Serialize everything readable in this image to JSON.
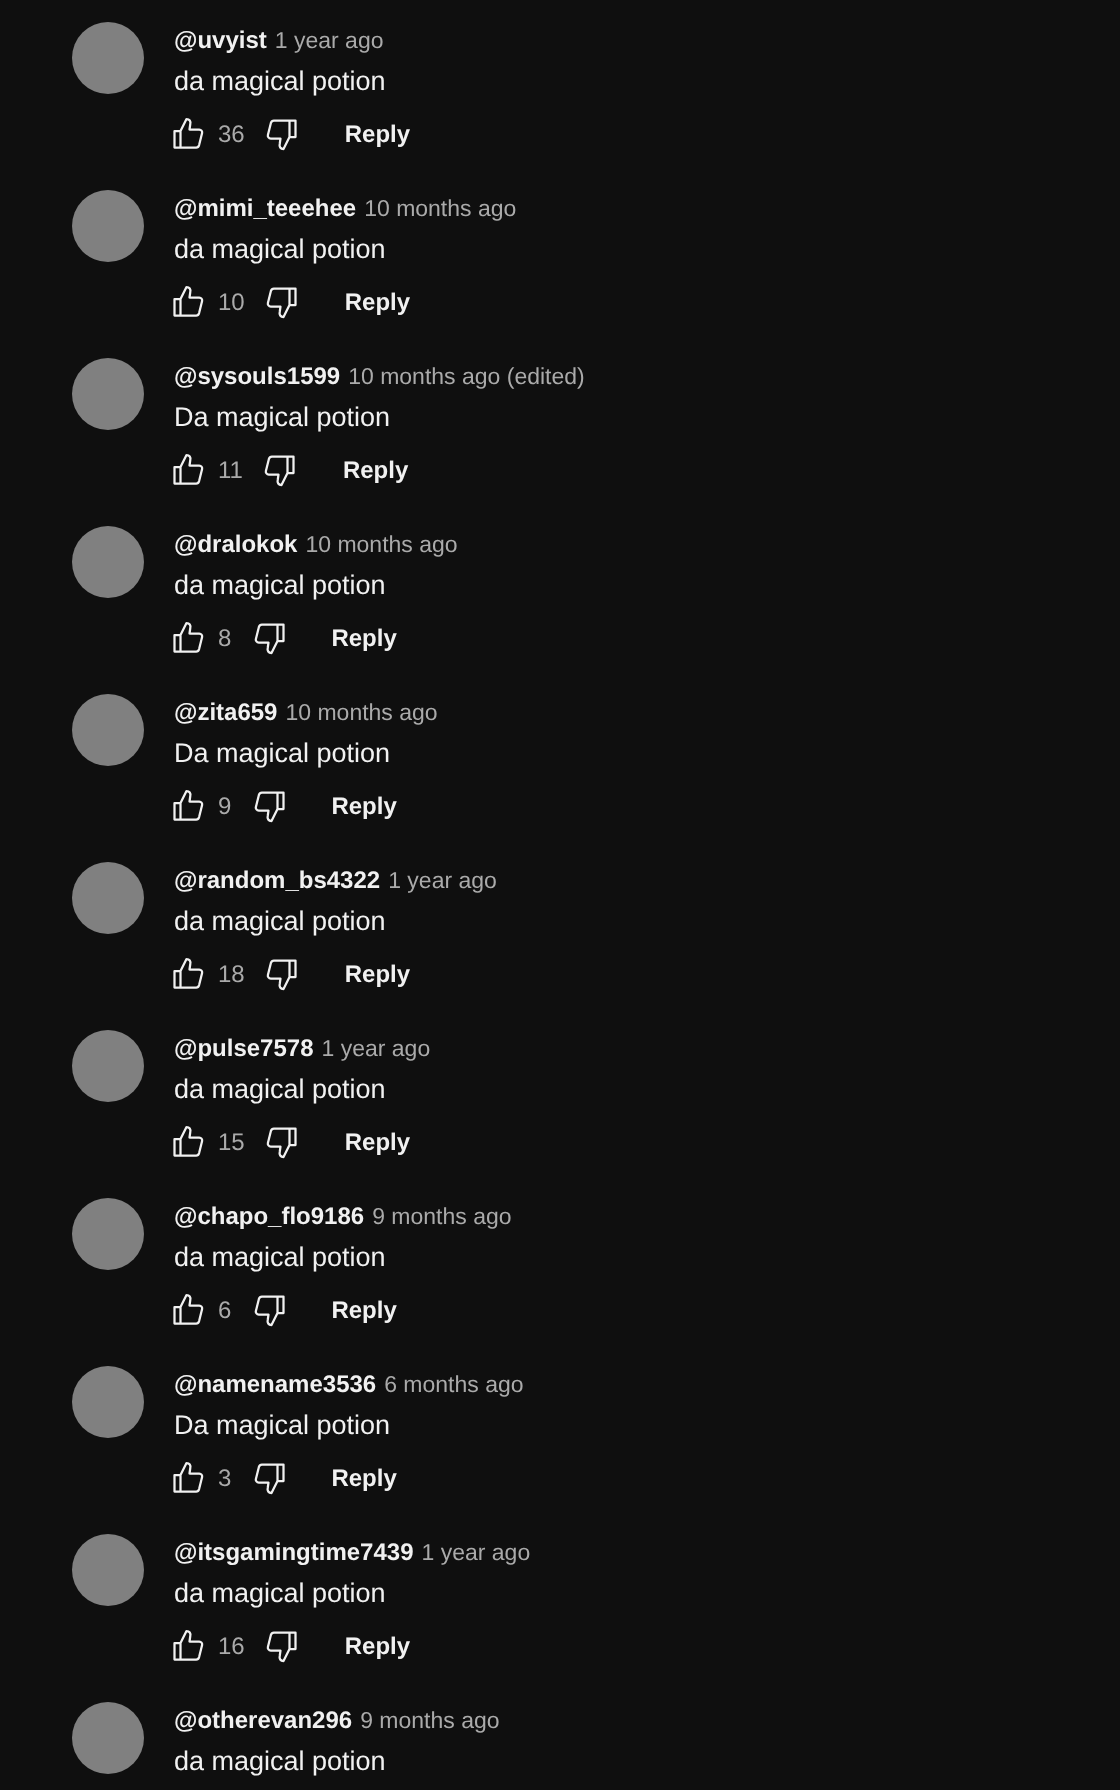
{
  "comments": [
    {
      "author": "@uvyist",
      "time": "1 year ago",
      "text": "da magical potion",
      "likes": "36",
      "reply": "Reply"
    },
    {
      "author": "@mimi_teeehee",
      "time": "10 months ago",
      "text": "da magical potion",
      "likes": "10",
      "reply": "Reply"
    },
    {
      "author": "@sysouls1599",
      "time": "10 months ago (edited)",
      "text": "Da magical potion",
      "likes": "11",
      "reply": "Reply"
    },
    {
      "author": "@dralokok",
      "time": "10 months ago",
      "text": "da magical potion",
      "likes": "8",
      "reply": "Reply"
    },
    {
      "author": "@zita659",
      "time": "10 months ago",
      "text": "Da magical potion",
      "likes": "9",
      "reply": "Reply"
    },
    {
      "author": "@random_bs4322",
      "time": "1 year ago",
      "text": "da magical potion",
      "likes": "18",
      "reply": "Reply"
    },
    {
      "author": "@pulse7578",
      "time": "1 year ago",
      "text": "da magical potion",
      "likes": "15",
      "reply": "Reply"
    },
    {
      "author": "@chapo_flo9186",
      "time": "9 months ago",
      "text": "da magical potion",
      "likes": "6",
      "reply": "Reply"
    },
    {
      "author": "@namename3536",
      "time": "6 months ago",
      "text": "Da magical potion",
      "likes": "3",
      "reply": "Reply"
    },
    {
      "author": "@itsgamingtime7439",
      "time": "1 year ago",
      "text": "da magical potion",
      "likes": "16",
      "reply": "Reply"
    },
    {
      "author": "@otherevan296",
      "time": "9 months ago",
      "text": "da magical potion"
    }
  ]
}
